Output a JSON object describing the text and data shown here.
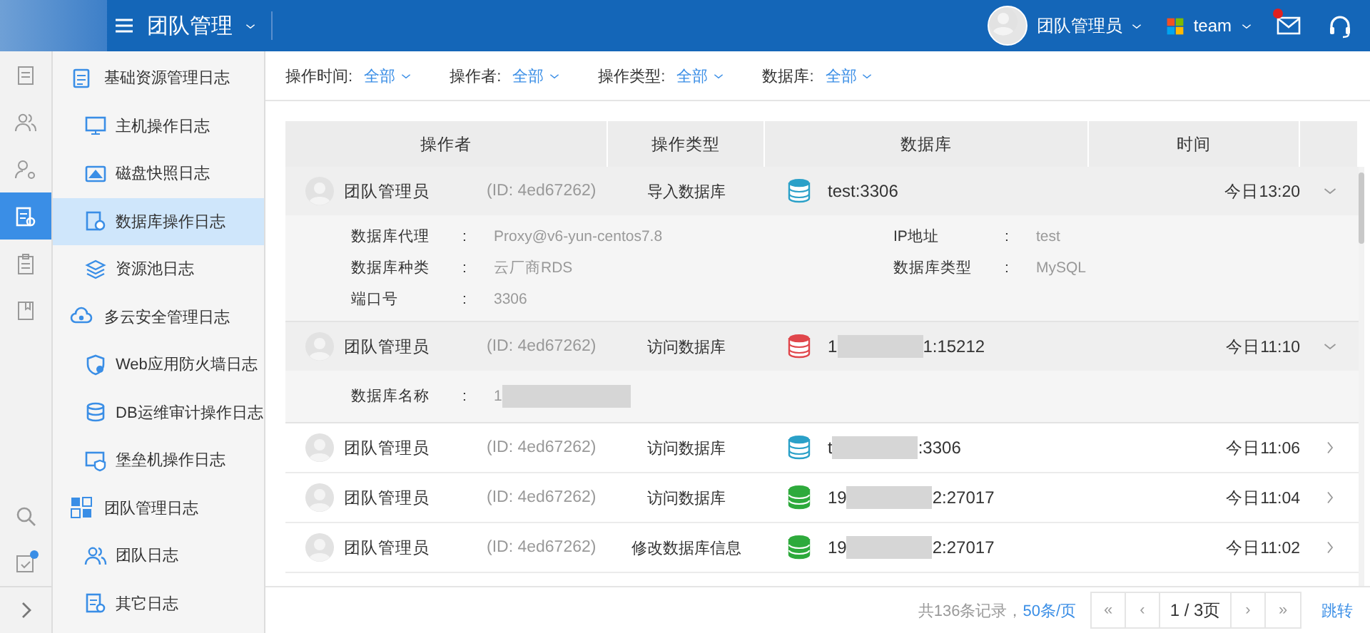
{
  "header": {
    "title": "团队管理",
    "user": "团队管理员",
    "team": "team",
    "mail_unread": true
  },
  "rail": [
    {
      "selected": false,
      "badge": false
    },
    {
      "selected": false,
      "badge": false
    },
    {
      "selected": false,
      "badge": false
    },
    {
      "selected": true,
      "badge": false
    },
    {
      "selected": false,
      "badge": false
    },
    {
      "selected": false,
      "badge": false
    }
  ],
  "rail_bottom": [
    {
      "selected": false,
      "badge": false
    },
    {
      "selected": false,
      "badge": true
    }
  ],
  "nav": [
    {
      "label": "基础资源管理日志",
      "selected": false,
      "children": [
        {
          "label": "主机操作日志",
          "selected": false
        },
        {
          "label": "磁盘快照日志",
          "selected": false
        },
        {
          "label": "数据库操作日志",
          "selected": true
        },
        {
          "label": "资源池日志",
          "selected": false
        }
      ]
    },
    {
      "label": "多云安全管理日志",
      "selected": false,
      "children": [
        {
          "label": "Web应用防火墙日志",
          "selected": false
        },
        {
          "label": "DB运维审计操作日志",
          "selected": false
        },
        {
          "label": "堡垒机操作日志",
          "selected": false
        }
      ]
    },
    {
      "label": "团队管理日志",
      "selected": false,
      "children": [
        {
          "label": "团队日志",
          "selected": false
        },
        {
          "label": "其它日志",
          "selected": false
        }
      ]
    }
  ],
  "filters": [
    {
      "label": "操作时间:",
      "value": "全部"
    },
    {
      "label": "操作者:",
      "value": "全部"
    },
    {
      "label": "操作类型:",
      "value": "全部"
    },
    {
      "label": "数据库:",
      "value": "全部"
    }
  ],
  "table": {
    "columns": [
      "操作者",
      "操作类型",
      "数据库",
      "时间"
    ],
    "rows": [
      {
        "operator": "团队管理员",
        "id": "(ID:  4ed67262)",
        "action": "导入数据库",
        "db": {
          "kind": "mysql",
          "prefix": "test:3306",
          "redacted": false
        },
        "time": "今日13:20",
        "expanded": true,
        "details": [
          {
            "label": "数据库代理",
            "colon": ":",
            "value": "Proxy@v6-yun-centos7.8",
            "redacted": false
          },
          {
            "label": "IP地址",
            "colon": ":",
            "value": "test",
            "redacted": false
          },
          {
            "label": "数据库种类",
            "colon": ":",
            "value": "云厂商RDS",
            "redacted": false
          },
          {
            "label": "数据库类型",
            "colon": ":",
            "value": "MySQL",
            "redacted": false
          },
          {
            "label": "端口号",
            "colon": ":",
            "value": "3306",
            "redacted": false
          }
        ]
      },
      {
        "operator": "团队管理员",
        "id": "(ID:  4ed67262)",
        "action": "访问数据库",
        "db": {
          "kind": "oracle",
          "prefix": "1",
          "redacted": true,
          "suffix": "1:15212"
        },
        "time": "今日11:10",
        "expanded": true,
        "details": [
          {
            "label": "数据库名称",
            "colon": ":",
            "value": "1",
            "redacted": true
          }
        ]
      },
      {
        "operator": "团队管理员",
        "id": "(ID:  4ed67262)",
        "action": "访问数据库",
        "db": {
          "kind": "mysql",
          "prefix": "t",
          "redacted": true,
          "suffix": ":3306"
        },
        "time": "今日11:06",
        "expanded": false
      },
      {
        "operator": "团队管理员",
        "id": "(ID:  4ed67262)",
        "action": "访问数据库",
        "db": {
          "kind": "mongodb",
          "prefix": "19",
          "redacted": true,
          "suffix": "2:27017"
        },
        "time": "今日11:04",
        "expanded": false
      },
      {
        "operator": "团队管理员",
        "id": "(ID:  4ed67262)",
        "action": "修改数据库信息",
        "db": {
          "kind": "mongodb",
          "prefix": "19",
          "redacted": true,
          "suffix": "2:27017"
        },
        "time": "今日11:02",
        "expanded": false
      }
    ]
  },
  "footer": {
    "summary": "共136条记录，",
    "per_page": "50条/页",
    "pager": [
      "«",
      "‹",
      "1 / 3页",
      "›",
      "»"
    ],
    "jump": "跳转"
  }
}
